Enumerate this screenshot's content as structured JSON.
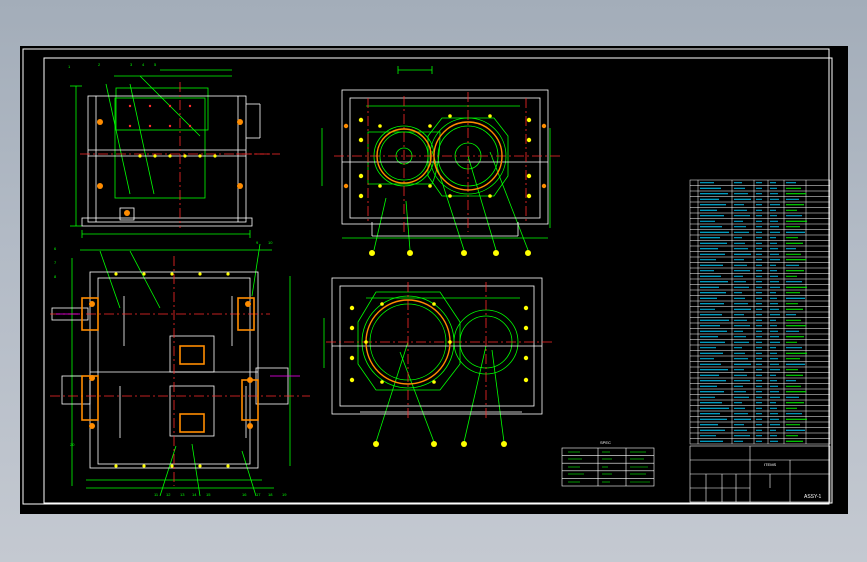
{
  "drawing": {
    "sheet_number": "ASSY-1",
    "parts_table_caption": "ITEMS",
    "tech_table_caption": "SPEC",
    "callout_marks": [
      "1",
      "2",
      "3",
      "4",
      "5",
      "6",
      "7",
      "8",
      "9",
      "10",
      "11",
      "12",
      "13",
      "14",
      "15",
      "16",
      "17",
      "18",
      "19",
      "20"
    ]
  },
  "colors": {
    "background": "#000000",
    "outline": "#ffffff",
    "center_line": "#ff2a2a",
    "dimension": "#00ff00",
    "bolt": "#ffff00",
    "hidden": "#ff00ff",
    "hatch": "#ff8c00",
    "border": "#ffffff"
  }
}
